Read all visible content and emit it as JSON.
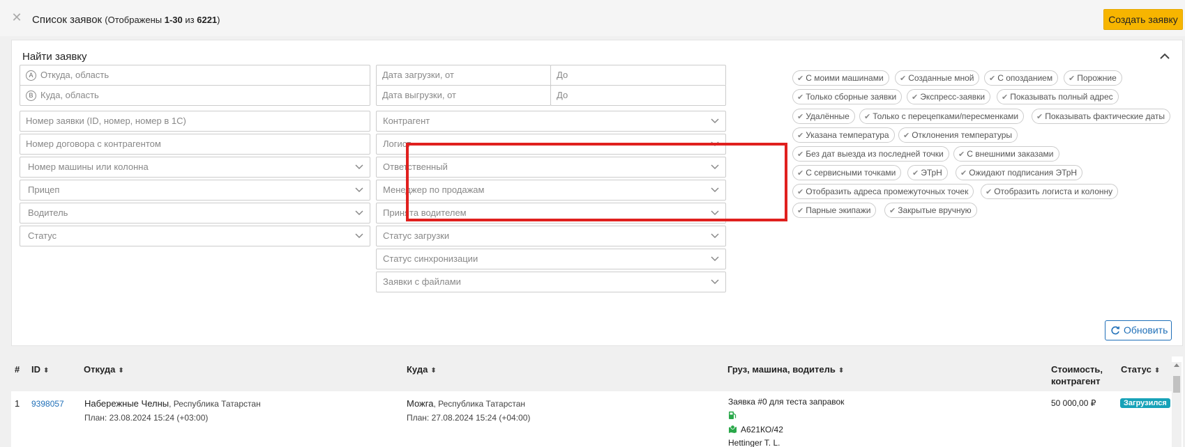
{
  "header": {
    "title": "Список заявок",
    "shown_prefix": "(Отображены ",
    "shown_range": "1-30",
    "shown_of": " из ",
    "shown_total": "6221",
    "shown_suffix": ")",
    "create_button": "Создать заявку"
  },
  "filter": {
    "title": "Найти заявку",
    "from_region": "Откуда, область",
    "to_region": "Куда, область",
    "from_marker": "A",
    "to_marker": "B",
    "order_number": "Номер заявки (ID, номер, номер в 1С)",
    "contract_number": "Номер договора с контрагентом",
    "vehicle": "Номер машины или колонна",
    "trailer": "Прицеп",
    "driver": "Водитель",
    "status": "Статус",
    "load_date_from": "Дата загрузки, от",
    "load_date_to": "До",
    "unload_date_from": "Дата выгрузки, от",
    "unload_date_to": "До",
    "counterparty": "Контрагент",
    "logist": "Логист",
    "responsible": "Ответственный",
    "sales_manager": "Менеджер по продажам",
    "accepted_by_driver": "Принята водителем",
    "load_status": "Статус загрузки",
    "sync_status": "Статус синхронизации",
    "with_files": "Заявки с файлами",
    "refresh_button": "Обновить"
  },
  "tags": [
    "С моими машинами",
    "Созданные мной",
    "С опозданием",
    "Порожние",
    "Только сборные заявки",
    "Экспресс-заявки",
    "Показывать полный адрес",
    "Удалённые",
    "Только с перецепками/пересменками",
    "Показывать фактические даты",
    "Указана температура",
    "Отклонения температуры",
    "Без дат выезда из последней точки",
    "С внешними заказами",
    "С сервисными точками",
    "ЭТрН",
    "Ожидают подписания ЭТрН",
    "Отобразить адреса промежуточных точек",
    "Отобразить логиста и колонну",
    "Парные экипажи",
    "Закрытые вручную"
  ],
  "table": {
    "headers": {
      "num": "#",
      "id": "ID",
      "from": "Откуда",
      "to": "Куда",
      "cargo": "Груз, машина, водитель",
      "cost_line1": "Стоимость,",
      "cost_line2": "контрагент",
      "status": "Статус"
    },
    "rows": [
      {
        "num": "1",
        "id": "9398057",
        "from_city": "Набережные Челны",
        "from_region": ", Республика Татарстан",
        "from_plan": "План: 23.08.2024 15:24 (+03:00)",
        "to_city": "Можга",
        "to_region": ", Республика Татарстан",
        "to_plan": "План: 27.08.2024 15:24 (+04:00)",
        "cargo": "Заявка #0 для теста заправок",
        "plate": "А621КО/42",
        "driver": "Hettinger T. L.",
        "cost": "50 000,00 ₽",
        "status": "Загрузился"
      }
    ]
  },
  "colors": {
    "accent": "#f7b500",
    "link": "#1f6fb8",
    "highlight": "#e0201e",
    "status_badge": "#17a2b8",
    "icon_green": "#2aa84a"
  }
}
